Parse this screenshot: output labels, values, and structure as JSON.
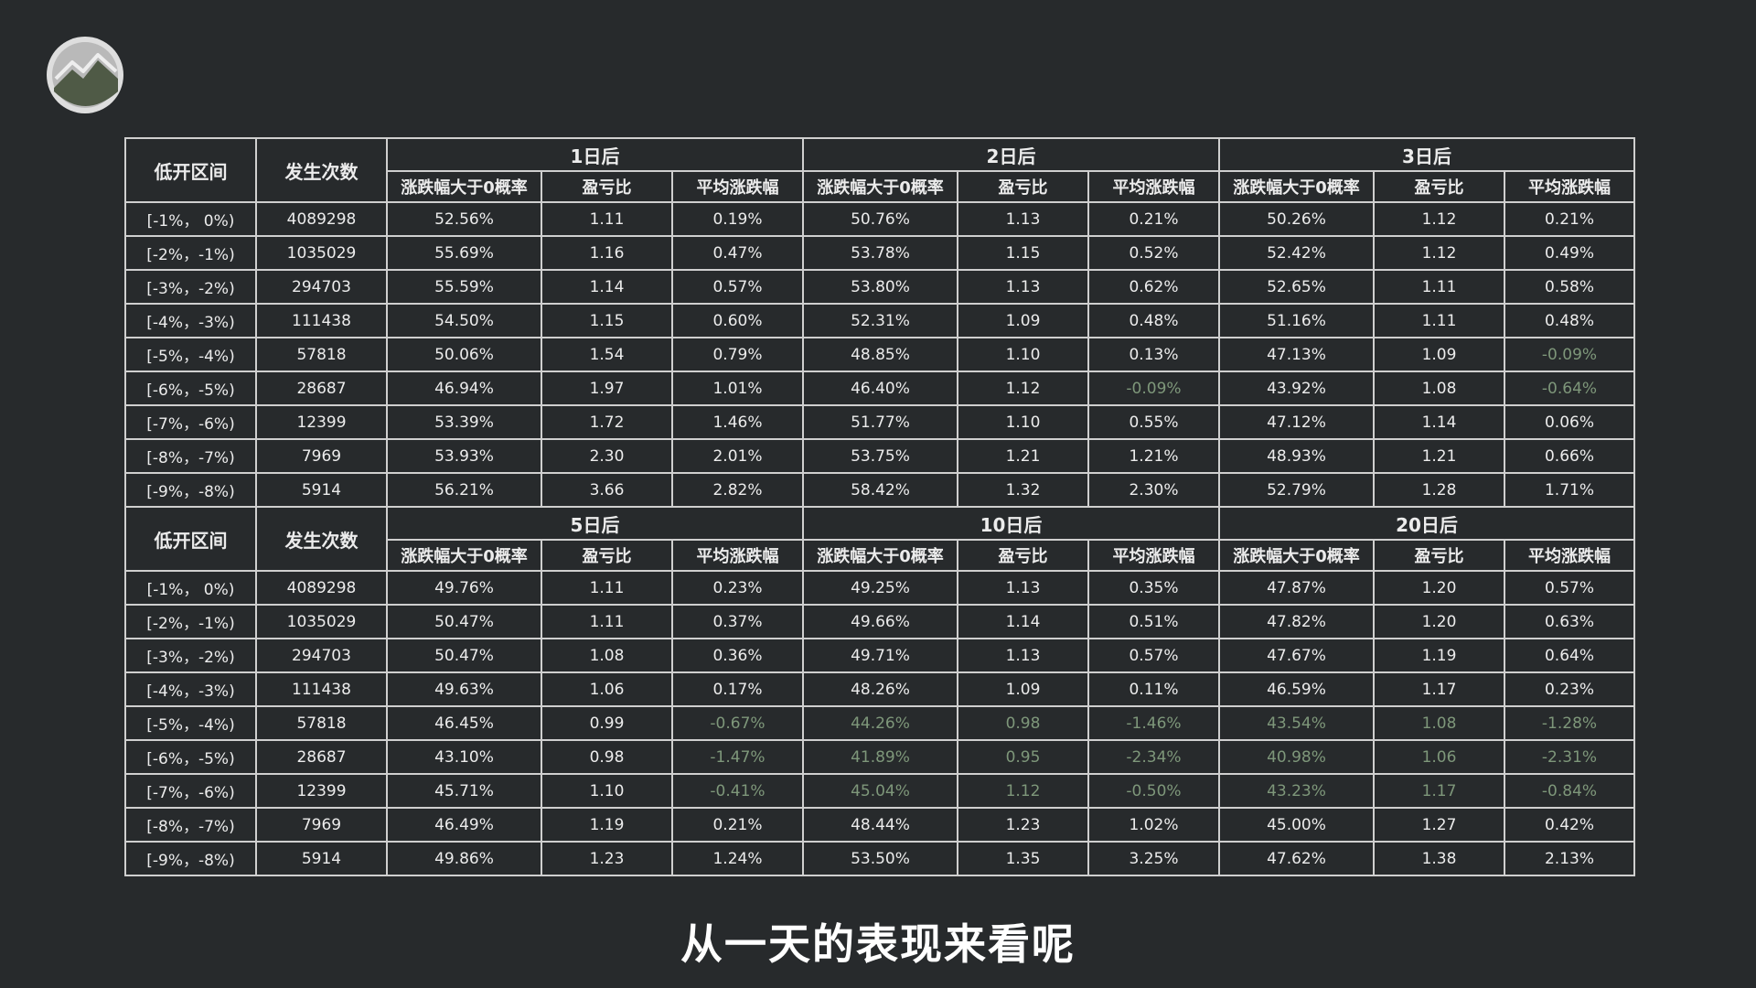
{
  "subtitle": "从一天的表现来看呢",
  "colors": {
    "background": "#272a2c",
    "grid": "#cfcfcf",
    "text": "#ececec",
    "negative_text": "#7e977a"
  },
  "logo": {
    "icon": "mountain-logo-icon"
  },
  "table": {
    "col_interval": "低开区间",
    "col_count": "发生次数",
    "metrics": [
      "涨跌幅大于0概率",
      "盈亏比",
      "平均涨跌幅"
    ],
    "blocks": [
      {
        "groups": [
          "1日后",
          "2日后",
          "3日后"
        ],
        "rows": [
          {
            "interval": "[-1%， 0%)",
            "count": "4089298",
            "cells": [
              "52.56%",
              "1.11",
              "0.19%",
              "50.76%",
              "1.13",
              "0.21%",
              "50.26%",
              "1.12",
              "0.21%"
            ]
          },
          {
            "interval": "[-2%，-1%)",
            "count": "1035029",
            "cells": [
              "55.69%",
              "1.16",
              "0.47%",
              "53.78%",
              "1.15",
              "0.52%",
              "52.42%",
              "1.12",
              "0.49%"
            ]
          },
          {
            "interval": "[-3%，-2%)",
            "count": "294703",
            "cells": [
              "55.59%",
              "1.14",
              "0.57%",
              "53.80%",
              "1.13",
              "0.62%",
              "52.65%",
              "1.11",
              "0.58%"
            ]
          },
          {
            "interval": "[-4%，-3%)",
            "count": "111438",
            "cells": [
              "54.50%",
              "1.15",
              "0.60%",
              "52.31%",
              "1.09",
              "0.48%",
              "51.16%",
              "1.11",
              "0.48%"
            ]
          },
          {
            "interval": "[-5%，-4%)",
            "count": "57818",
            "cells": [
              "50.06%",
              "1.54",
              "0.79%",
              "48.85%",
              "1.10",
              "0.13%",
              "47.13%",
              "1.09",
              "-0.09%"
            ]
          },
          {
            "interval": "[-6%，-5%)",
            "count": "28687",
            "cells": [
              "46.94%",
              "1.97",
              "1.01%",
              "46.40%",
              "1.12",
              "-0.09%",
              "43.92%",
              "1.08",
              "-0.64%"
            ]
          },
          {
            "interval": "[-7%，-6%)",
            "count": "12399",
            "cells": [
              "53.39%",
              "1.72",
              "1.46%",
              "51.77%",
              "1.10",
              "0.55%",
              "47.12%",
              "1.14",
              "0.06%"
            ]
          },
          {
            "interval": "[-8%，-7%)",
            "count": "7969",
            "cells": [
              "53.93%",
              "2.30",
              "2.01%",
              "53.75%",
              "1.21",
              "1.21%",
              "48.93%",
              "1.21",
              "0.66%"
            ]
          },
          {
            "interval": "[-9%，-8%)",
            "count": "5914",
            "cells": [
              "56.21%",
              "3.66",
              "2.82%",
              "58.42%",
              "1.32",
              "2.30%",
              "52.79%",
              "1.28",
              "1.71%"
            ]
          }
        ]
      },
      {
        "groups": [
          "5日后",
          "10日后",
          "20日后"
        ],
        "rows": [
          {
            "interval": "[-1%， 0%)",
            "count": "4089298",
            "cells": [
              "49.76%",
              "1.11",
              "0.23%",
              "49.25%",
              "1.13",
              "0.35%",
              "47.87%",
              "1.20",
              "0.57%"
            ]
          },
          {
            "interval": "[-2%，-1%)",
            "count": "1035029",
            "cells": [
              "50.47%",
              "1.11",
              "0.37%",
              "49.66%",
              "1.14",
              "0.51%",
              "47.82%",
              "1.20",
              "0.63%"
            ]
          },
          {
            "interval": "[-3%，-2%)",
            "count": "294703",
            "cells": [
              "50.47%",
              "1.08",
              "0.36%",
              "49.71%",
              "1.13",
              "0.57%",
              "47.67%",
              "1.19",
              "0.64%"
            ]
          },
          {
            "interval": "[-4%，-3%)",
            "count": "111438",
            "cells": [
              "49.63%",
              "1.06",
              "0.17%",
              "48.26%",
              "1.09",
              "0.11%",
              "46.59%",
              "1.17",
              "0.23%"
            ]
          },
          {
            "interval": "[-5%，-4%)",
            "count": "57818",
            "cells": [
              "46.45%",
              "0.99",
              "-0.67%",
              "44.26%",
              "0.98",
              "-1.46%",
              "43.54%",
              "1.08",
              "-1.28%"
            ]
          },
          {
            "interval": "[-6%，-5%)",
            "count": "28687",
            "cells": [
              "43.10%",
              "0.98",
              "-1.47%",
              "41.89%",
              "0.95",
              "-2.34%",
              "40.98%",
              "1.06",
              "-2.31%"
            ]
          },
          {
            "interval": "[-7%，-6%)",
            "count": "12399",
            "cells": [
              "45.71%",
              "1.10",
              "-0.41%",
              "45.04%",
              "1.12",
              "-0.50%",
              "43.23%",
              "1.17",
              "-0.84%"
            ]
          },
          {
            "interval": "[-8%，-7%)",
            "count": "7969",
            "cells": [
              "46.49%",
              "1.19",
              "0.21%",
              "48.44%",
              "1.23",
              "1.02%",
              "45.00%",
              "1.27",
              "0.42%"
            ]
          },
          {
            "interval": "[-9%，-8%)",
            "count": "5914",
            "cells": [
              "49.86%",
              "1.23",
              "1.24%",
              "53.50%",
              "1.35",
              "3.25%",
              "47.62%",
              "1.38",
              "2.13%"
            ]
          }
        ],
        "dimmed_cells": [
          [
            4,
            3
          ],
          [
            4,
            4
          ],
          [
            4,
            6
          ],
          [
            4,
            7
          ],
          [
            5,
            3
          ],
          [
            5,
            4
          ],
          [
            5,
            6
          ],
          [
            5,
            7
          ],
          [
            6,
            3
          ],
          [
            6,
            4
          ],
          [
            6,
            6
          ],
          [
            6,
            7
          ]
        ]
      }
    ]
  }
}
